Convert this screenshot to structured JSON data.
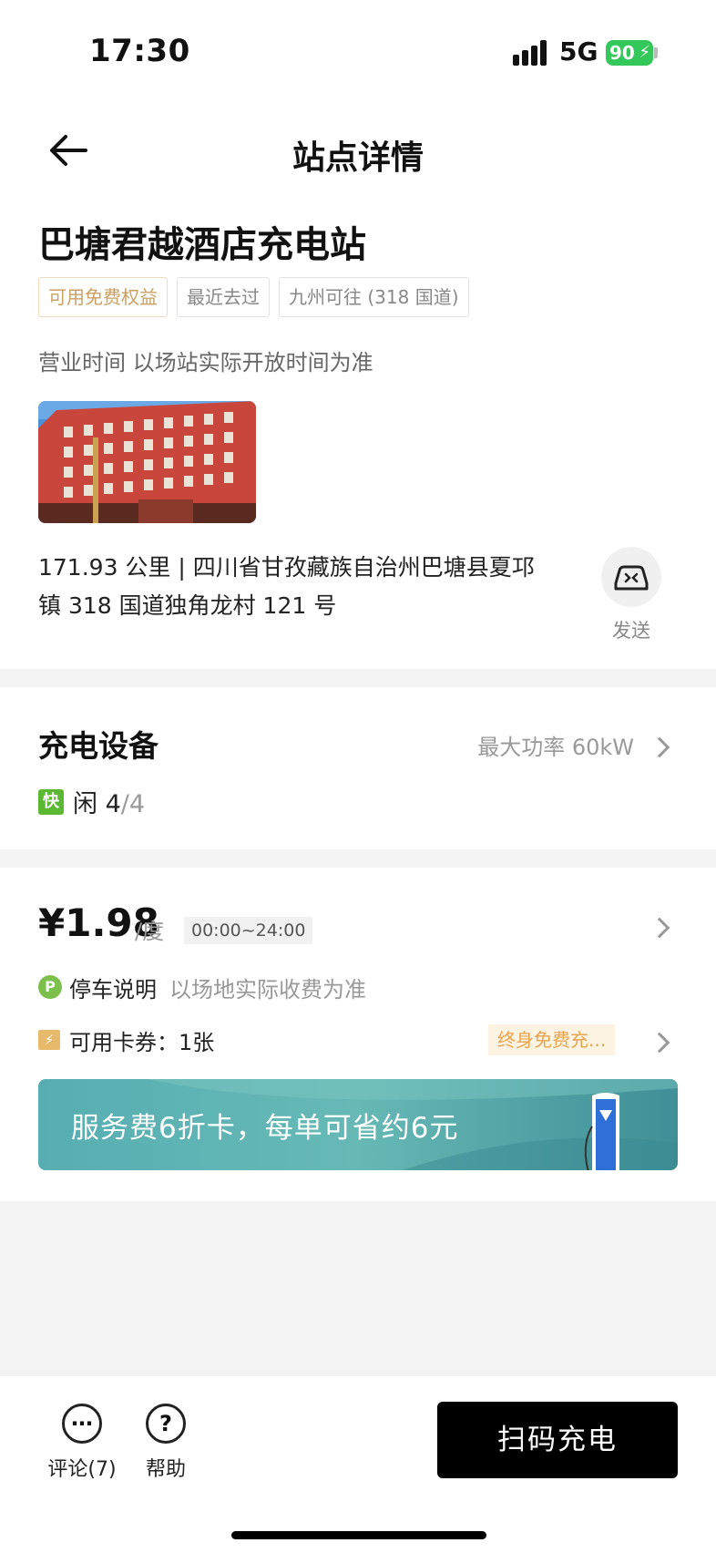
{
  "status_bar": {
    "time": "17:30",
    "network": "5G",
    "battery": "90"
  },
  "nav": {
    "title": "站点详情"
  },
  "station": {
    "name": "巴塘君越酒店充电站",
    "tags": [
      "可用免费权益",
      "最近去过",
      "九州可往 (318 国道)"
    ],
    "hours": "营业时间 以场站实际开放时间为准",
    "address": "171.93 公里 | 四川省甘孜藏族自治州巴塘县夏邛镇 318 国道独角龙村 121 号",
    "send_label": "发送"
  },
  "equipment": {
    "title": "充电设备",
    "max_power": "最大功率 60kW",
    "fast_label": "快",
    "idle_label": "闲",
    "idle_count": "4",
    "total_count": "/4"
  },
  "pricing": {
    "price": "¥1.98",
    "unit": "/度",
    "time_range": "00:00~24:00",
    "parking_icon": "P",
    "parking_label": "停车说明",
    "parking_note": "以场地实际收费为准",
    "coupon_label": "可用卡券：1张",
    "coupon_promo": "终身免费充...",
    "banner_text": "服务费6折卡，每单可省约6元"
  },
  "bottom": {
    "comment_label": "评论(7)",
    "help_label": "帮助",
    "scan_label": "扫码充电"
  },
  "colors": {
    "accent_green": "#5ab833",
    "gold_tag": "#c9a063",
    "promo_orange": "#e8a44c",
    "banner_teal": "#5fb3b4",
    "battery_green": "#34c759"
  },
  "icons": [
    "back-arrow-icon",
    "car-send-icon",
    "chevron-right-icon",
    "parking-icon",
    "coupon-icon",
    "comment-icon",
    "help-icon"
  ]
}
